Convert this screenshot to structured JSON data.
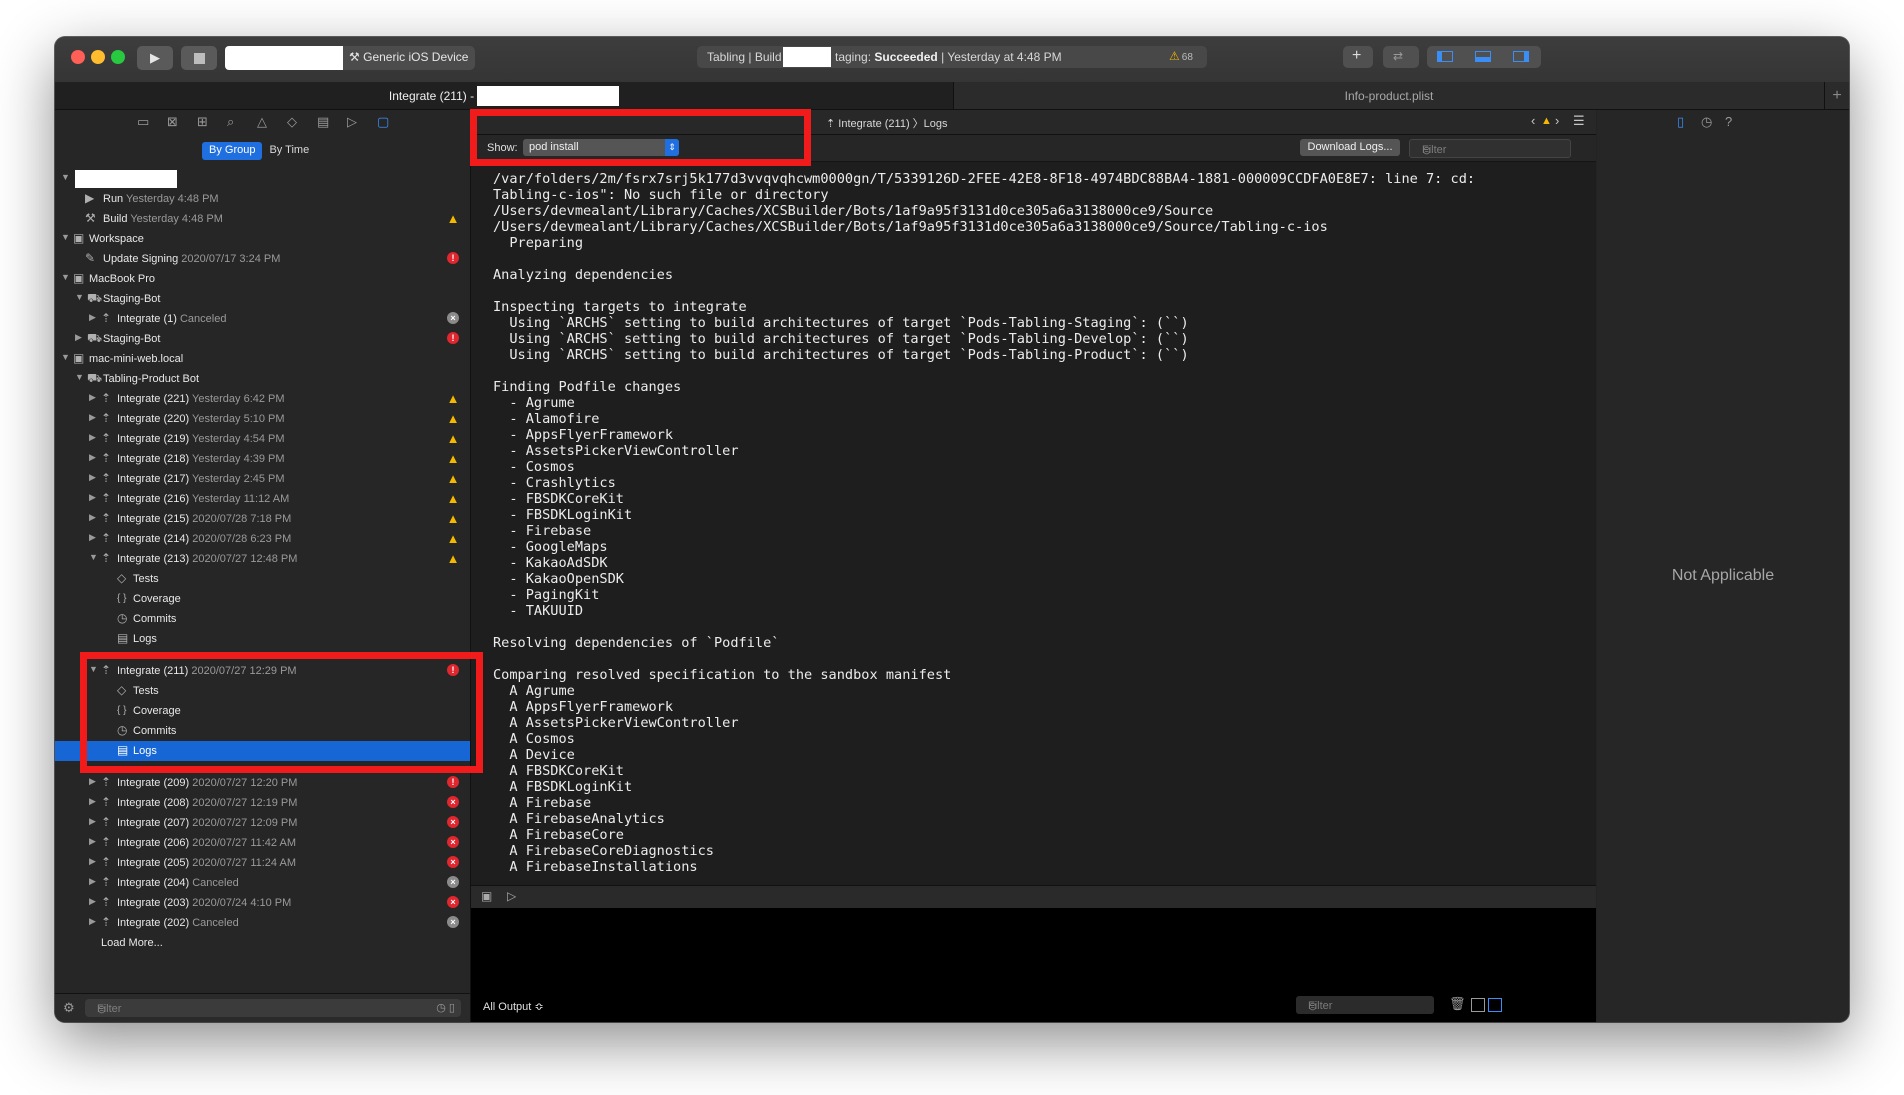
{
  "toolbar": {
    "scheme_device": "Generic iOS Device",
    "activity_prefix": "Tabling | Build",
    "activity_status_prefix": "taging: ",
    "activity_status": "Succeeded",
    "activity_time": " | Yesterday at 4:48 PM",
    "warning_count": "68"
  },
  "tabs": {
    "active": "Integrate (211) -",
    "inactive": "Info-product.plist"
  },
  "navigator": {
    "segments": [
      "By Group",
      "By Time"
    ],
    "rows": [
      {
        "label": "Run",
        "sub": "Yesterday 4:48 PM"
      },
      {
        "label": "Build",
        "sub": "Yesterday 4:48 PM"
      },
      {
        "label": "Workspace",
        "sub": ""
      },
      {
        "label": "Update Signing",
        "sub": "2020/07/17 3:24 PM"
      },
      {
        "label": "MacBook Pro",
        "sub": ""
      },
      {
        "label": "Staging-Bot",
        "sub": ""
      },
      {
        "label": "Integrate (1)",
        "sub": "Canceled"
      },
      {
        "label": "Staging-Bot",
        "sub": ""
      },
      {
        "label": "mac-mini-web.local",
        "sub": ""
      },
      {
        "label": "Tabling-Product Bot",
        "sub": ""
      },
      {
        "label": "Integrate (221)",
        "sub": "Yesterday 6:42 PM"
      },
      {
        "label": "Integrate (220)",
        "sub": "Yesterday 5:10 PM"
      },
      {
        "label": "Integrate (219)",
        "sub": "Yesterday 4:54 PM"
      },
      {
        "label": "Integrate (218)",
        "sub": "Yesterday 4:39 PM"
      },
      {
        "label": "Integrate (217)",
        "sub": "Yesterday 2:45 PM"
      },
      {
        "label": "Integrate (216)",
        "sub": "Yesterday 11:12 AM"
      },
      {
        "label": "Integrate (215)",
        "sub": "2020/07/28 7:18 PM"
      },
      {
        "label": "Integrate (214)",
        "sub": "2020/07/28 6:23 PM"
      },
      {
        "label": "Integrate (213)",
        "sub": "2020/07/27 12:48 PM"
      },
      {
        "label": "Tests",
        "sub": ""
      },
      {
        "label": "Coverage",
        "sub": ""
      },
      {
        "label": "Commits",
        "sub": ""
      },
      {
        "label": "Logs",
        "sub": ""
      },
      {
        "label": "Integrate (211)",
        "sub": "2020/07/27 12:29 PM"
      },
      {
        "label": "Tests",
        "sub": ""
      },
      {
        "label": "Coverage",
        "sub": ""
      },
      {
        "label": "Commits",
        "sub": ""
      },
      {
        "label": "Logs",
        "sub": ""
      },
      {
        "label": "Integrate (209)",
        "sub": "2020/07/27 12:20 PM"
      },
      {
        "label": "Integrate (208)",
        "sub": "2020/07/27 12:19 PM"
      },
      {
        "label": "Integrate (207)",
        "sub": "2020/07/27 12:09 PM"
      },
      {
        "label": "Integrate (206)",
        "sub": "2020/07/27 11:42 AM"
      },
      {
        "label": "Integrate (205)",
        "sub": "2020/07/27 11:24 AM"
      },
      {
        "label": "Integrate (204)",
        "sub": "Canceled"
      },
      {
        "label": "Integrate (203)",
        "sub": "2020/07/24 4:10 PM"
      },
      {
        "label": "Integrate (202)",
        "sub": "Canceled"
      }
    ],
    "load_more": "Load More...",
    "filter_placeholder": "Filter"
  },
  "editor": {
    "breadcrumb": "Integrate (211) 〉Logs",
    "show_label": "Show:",
    "show_value": "pod install",
    "download_logs": "Download Logs...",
    "filter_placeholder": "Filter",
    "log_lines": [
      "/var/folders/2m/fsrx7srj5k177d3vvqvqhcwm0000gn/T/5339126D-2FEE-42E8-8F18-4974BDC88BA4-1881-000009CCDFA0E8E7: line 7: cd:",
      "Tabling-c-ios\": No such file or directory",
      "/Users/devmealant/Library/Caches/XCSBuilder/Bots/1af9a95f3131d0ce305a6a3138000ce9/Source",
      "/Users/devmealant/Library/Caches/XCSBuilder/Bots/1af9a95f3131d0ce305a6a3138000ce9/Source/Tabling-c-ios",
      "  Preparing",
      "",
      "Analyzing dependencies",
      "",
      "Inspecting targets to integrate",
      "  Using `ARCHS` setting to build architectures of target `Pods-Tabling-Staging`: (``)",
      "  Using `ARCHS` setting to build architectures of target `Pods-Tabling-Develop`: (``)",
      "  Using `ARCHS` setting to build architectures of target `Pods-Tabling-Product`: (``)",
      "",
      "Finding Podfile changes",
      "  - Agrume",
      "  - Alamofire",
      "  - AppsFlyerFramework",
      "  - AssetsPickerViewController",
      "  - Cosmos",
      "  - Crashlytics",
      "  - FBSDKCoreKit",
      "  - FBSDKLoginKit",
      "  - Firebase",
      "  - GoogleMaps",
      "  - KakaoAdSDK",
      "  - KakaoOpenSDK",
      "  - PagingKit",
      "  - TAKUUID",
      "",
      "Resolving dependencies of `Podfile`",
      "",
      "Comparing resolved specification to the sandbox manifest",
      "  A Agrume",
      "  A AppsFlyerFramework",
      "  A AssetsPickerViewController",
      "  A Cosmos",
      "  A Device",
      "  A FBSDKCoreKit",
      "  A FBSDKLoginKit",
      "  A Firebase",
      "  A FirebaseAnalytics",
      "  A FirebaseCore",
      "  A FirebaseCoreDiagnostics",
      "  A FirebaseInstallations"
    ]
  },
  "console": {
    "output_selector": "All Output ≎",
    "filter_placeholder": "Filter"
  },
  "inspector": {
    "not_applicable": "Not Applicable"
  },
  "colors": {
    "selection": "#1766d6",
    "annotation": "#f21b1b",
    "warning": "#f5b800",
    "error": "#e0262e"
  }
}
